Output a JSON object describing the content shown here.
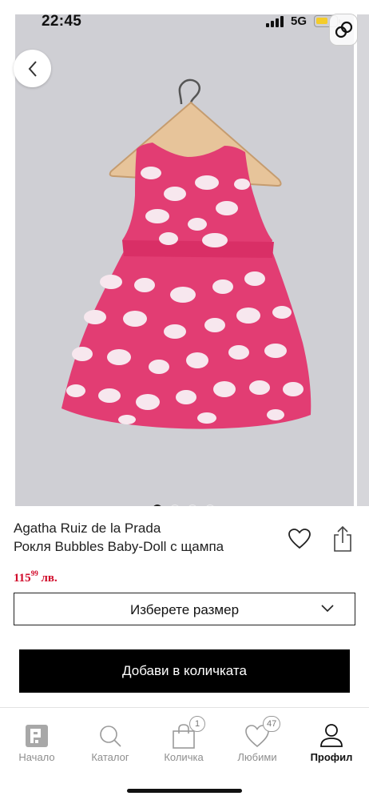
{
  "status_bar": {
    "time": "22:45",
    "network": "5G"
  },
  "product": {
    "brand": "Agatha Ruiz de la Prada",
    "name": "Рокля Bubbles Baby-Doll с щампа",
    "price_main": "115",
    "price_cents": "99",
    "price_currency": " лв.",
    "image_description_icon": "dress-image",
    "gallery_dots": 4,
    "gallery_active_index": 0
  },
  "size_select": {
    "label": "Изберете размер"
  },
  "add_to_cart": {
    "label": "Добави в количката"
  },
  "tabs": [
    {
      "label": "Начало",
      "icon": "brand-logo-icon"
    },
    {
      "label": "Каталог",
      "icon": "search-icon"
    },
    {
      "label": "Количка",
      "icon": "bag-icon",
      "badge": "1"
    },
    {
      "label": "Любими",
      "icon": "heart-icon",
      "badge": "47"
    },
    {
      "label": "Профил",
      "icon": "profile-icon",
      "active": true
    }
  ],
  "colors": {
    "accent": "#000000",
    "price": "#d10a2a",
    "dress": "#e23d73",
    "background": "#cfcfd4"
  }
}
